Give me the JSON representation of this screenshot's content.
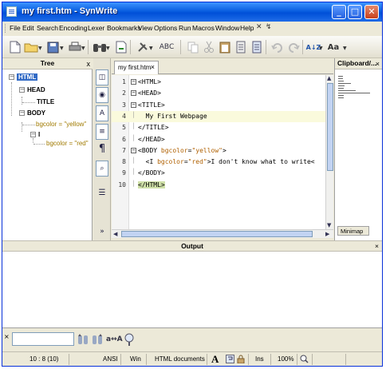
{
  "window": {
    "title": "my first.htm - SynWrite",
    "minimize_glyph": "_",
    "maximize_glyph": "□",
    "close_glyph": "✕"
  },
  "menu": [
    "File",
    "Edit",
    "Search",
    "Encoding",
    "Lexer",
    "Bookmarks",
    "View",
    "Options",
    "Run",
    "Macros",
    "Window",
    "Help"
  ],
  "menu_extra": {
    "close": "✕",
    "restore": "↯"
  },
  "toolbar": {
    "icons": [
      "new-file-icon",
      "open-folder-icon",
      "save-icon",
      "print-icon",
      "find-binoculars-icon",
      "export-icon",
      "settings-icon",
      "spellcheck-icon",
      "copy-icon",
      "cut-icon",
      "paste-icon",
      "clipboard-icon",
      "undo-icon",
      "redo-icon",
      "sort-icon",
      "font-case-icon"
    ],
    "spell_label": "ABC",
    "sort_label": "A↓Z",
    "case_label": "Aa"
  },
  "tree": {
    "header": "Tree",
    "close": "x",
    "nodes": {
      "html": "HTML",
      "head": "HEAD",
      "title": "TITLE",
      "body": "BODY",
      "body_attr": "bgcolor = \"yellow\"",
      "i": "I",
      "i_attr": "bgcolor = \"red\""
    }
  },
  "editor": {
    "tab_label": "my first.htm",
    "tab_close": "×",
    "lines": [
      {
        "n": "1",
        "text": "<HTML>"
      },
      {
        "n": "2",
        "text": "<HEAD>"
      },
      {
        "n": "3",
        "text": "<TITLE>"
      },
      {
        "n": "4",
        "text": "  My First Webpage"
      },
      {
        "n": "5",
        "text": "</TITLE>"
      },
      {
        "n": "6",
        "text": "</HEAD>"
      },
      {
        "n": "7",
        "text": "<BODY bgcolor=\"yellow\">"
      },
      {
        "n": "8",
        "text": "  <I bgcolor=\"red\">I don't know what to write<"
      },
      {
        "n": "9",
        "text": "</BODY>"
      },
      {
        "n": "10",
        "text": "</HTML>"
      }
    ]
  },
  "clipboard": {
    "header": "Clipboard/...",
    "close": "×",
    "tab": "Minimap"
  },
  "output": {
    "header": "Output",
    "close": "×"
  },
  "search": {
    "close": "×",
    "case_label": "a↔A"
  },
  "status": {
    "position": "10 : 8 (10)",
    "encoding": "ANSI",
    "line_ending": "Win",
    "lexer": "HTML documents",
    "font_glyph": "A",
    "mode": "Ins",
    "zoom": "100%"
  },
  "colors": {
    "titlebar": "#0a5fe0",
    "selection": "#316ac5",
    "current_line": "#fafadc",
    "attr": "#b06000"
  }
}
